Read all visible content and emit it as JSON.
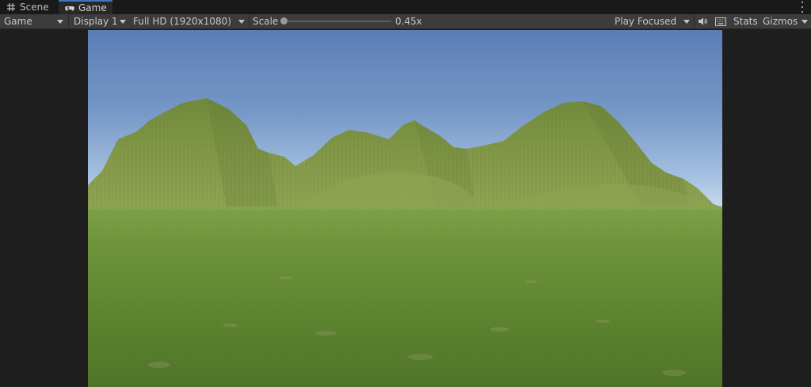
{
  "tabs": [
    {
      "label": "Scene",
      "icon": "grid-icon",
      "active": false
    },
    {
      "label": "Game",
      "icon": "gamepad-icon",
      "active": true
    }
  ],
  "toolbar": {
    "view_mode": "Game",
    "display": "Display 1",
    "resolution": "Full HD (1920x1080)",
    "scale_label": "Scale",
    "scale_value": "0.45x",
    "play_mode": "Play Focused",
    "stats_label": "Stats",
    "gizmos_label": "Gizmos"
  },
  "colors": {
    "active_tab_accent": "#3a79bb",
    "sky_top": "#5b7fb8",
    "sky_horizon": "#c9dcee",
    "mountain": "#7d9143",
    "grass": "#5f8a2f"
  }
}
